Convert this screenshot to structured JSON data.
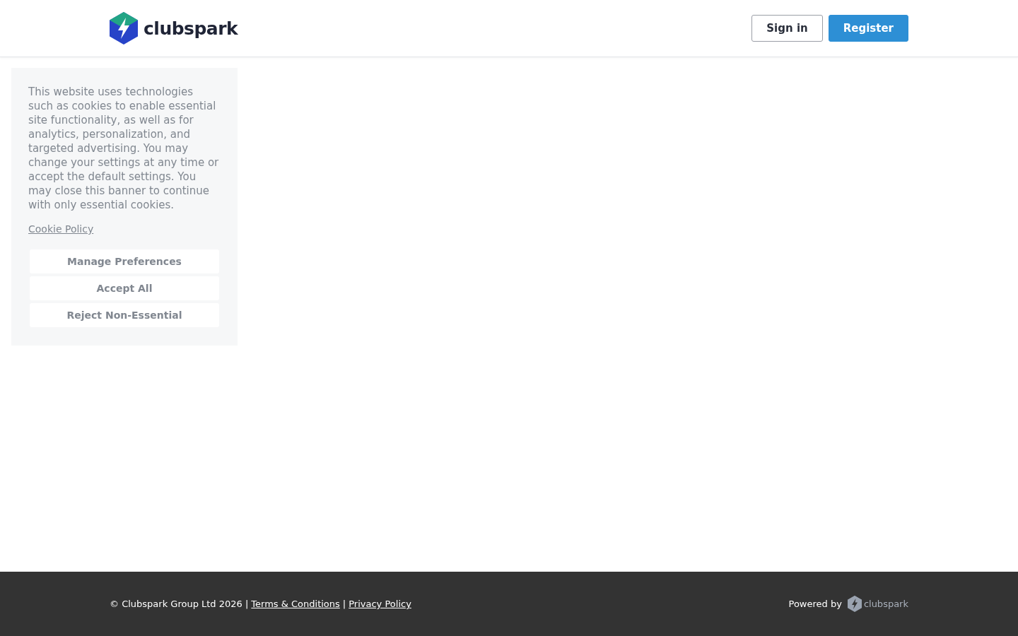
{
  "header": {
    "logo_text": "clubspark",
    "buttons": [
      {
        "label": "Sign in",
        "kind": "outline"
      },
      {
        "label": "Register",
        "kind": "primary"
      }
    ]
  },
  "cookie_banner": {
    "message": "This website uses technologies such as cookies to enable essential site functionality, as well as for analytics, personalization, and targeted advertising. You may change your settings at any time or accept the default settings. You may close this banner to continue with only essential cookies.",
    "policy_link": "Cookie Policy",
    "buttons": [
      "Manage Preferences",
      "Accept All",
      "Reject Non-Essential"
    ]
  },
  "footer": {
    "copyright": "© Clubspark Group Ltd 2026 |",
    "links": [
      {
        "label": "Terms & Conditions"
      },
      {
        "label": "Privacy Policy"
      }
    ],
    "separator": "|",
    "powered_by": "Powered by",
    "powered_logo_text": "clubspark"
  }
}
